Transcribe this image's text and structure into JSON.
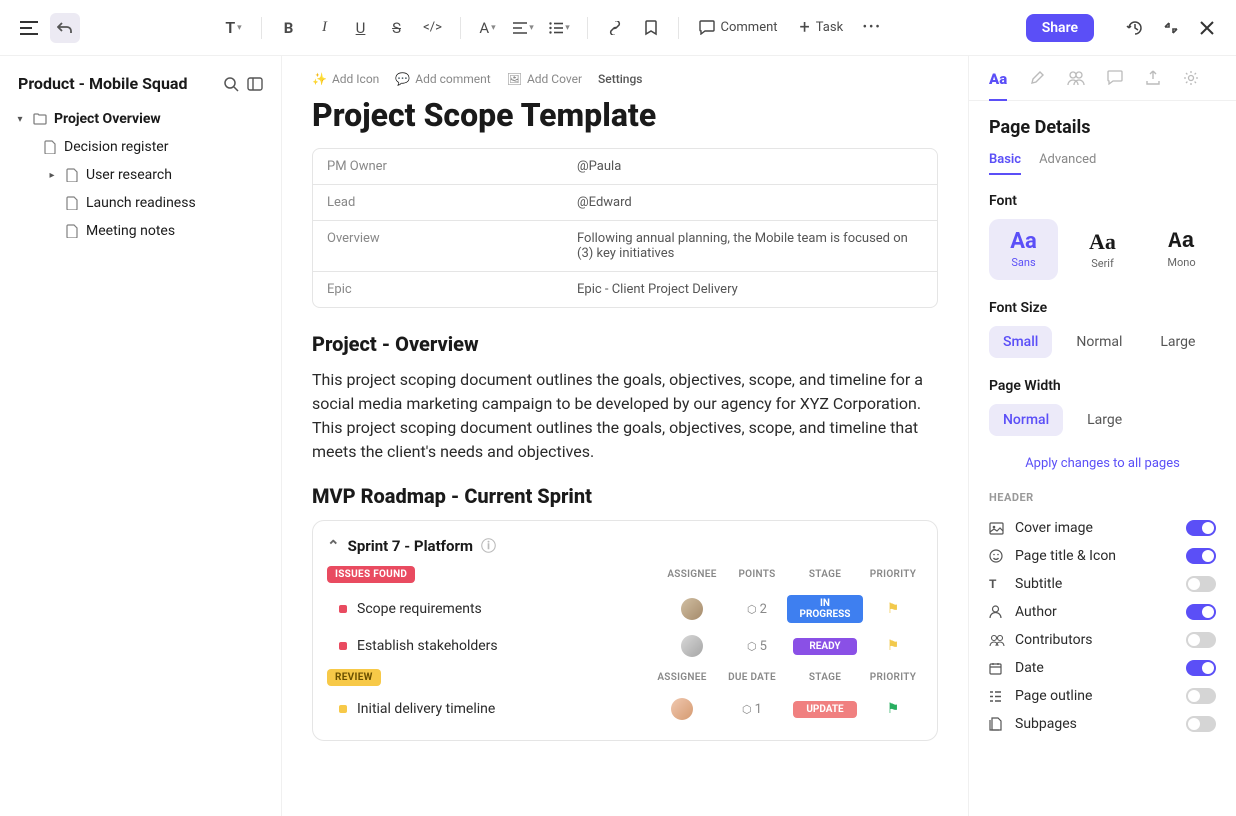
{
  "toolbar": {
    "comment": "Comment",
    "task": "Task",
    "share": "Share"
  },
  "sidebar": {
    "title": "Product - Mobile Squad",
    "tree": [
      {
        "label": "Project Overview",
        "bold": true,
        "expanded": true
      },
      {
        "label": "Decision register",
        "indent": 1
      },
      {
        "label": "User research",
        "indent": 2,
        "hasChildren": true
      },
      {
        "label": "Launch readiness",
        "indent": 2
      },
      {
        "label": "Meeting notes",
        "indent": 2
      }
    ]
  },
  "meta": {
    "addIcon": "Add Icon",
    "addComment": "Add comment",
    "addCover": "Add Cover",
    "settings": "Settings"
  },
  "page": {
    "title": "Project Scope Template",
    "info": [
      {
        "k": "PM Owner",
        "v": "@Paula"
      },
      {
        "k": "Lead",
        "v": "@Edward"
      },
      {
        "k": "Overview",
        "v": "Following annual planning, the Mobile team is focused on (3) key initiatives"
      },
      {
        "k": "Epic",
        "v": "Epic - Client Project Delivery"
      }
    ],
    "h2a": "Project - Overview",
    "para": "This project scoping document outlines the goals, objectives, scope, and timeline for a social media marketing campaign to be developed by our agency for XYZ Corporation. This project scoping document outlines the goals, objectives, scope, and timeline that meets the client's needs and objectives.",
    "h2b": "MVP Roadmap - Current Sprint"
  },
  "sprint": {
    "title": "Sprint  7 - Platform",
    "sections": [
      {
        "tag": "ISSUES FOUND",
        "tagClass": "tag-issues",
        "cols": [
          "ASSIGNEE",
          "POINTS",
          "STAGE",
          "PRIORITY"
        ],
        "tasks": [
          {
            "name": "Scope requirements",
            "points": "2",
            "stage": "IN PROGRESS",
            "stageClass": "st-progress",
            "flag": "flag-yellow",
            "avatar": ""
          },
          {
            "name": "Establish stakeholders",
            "points": "5",
            "stage": "READY",
            "stageClass": "st-ready",
            "flag": "flag-yellow",
            "avatar": "a2"
          }
        ]
      },
      {
        "tag": "REVIEW",
        "tagClass": "tag-review",
        "cols": [
          "ASSIGNEE",
          "DUE DATE",
          "STAGE",
          "PRIORITY"
        ],
        "tasks": [
          {
            "name": "Initial delivery timeline",
            "points": "1",
            "stage": "UPDATE",
            "stageClass": "st-update",
            "flag": "flag-green",
            "avatar": "a3",
            "dot": "dot-yellow"
          }
        ]
      }
    ]
  },
  "panel": {
    "title": "Page Details",
    "tabs": {
      "basic": "Basic",
      "advanced": "Advanced"
    },
    "fontLabel": "Font",
    "fonts": [
      {
        "sample": "Aa",
        "label": "Sans",
        "cls": "",
        "active": true
      },
      {
        "sample": "Aa",
        "label": "Serif",
        "cls": "font-serif"
      },
      {
        "sample": "Aa",
        "label": "Mono",
        "cls": "font-mono"
      }
    ],
    "sizeLabel": "Font Size",
    "sizes": [
      {
        "label": "Small",
        "active": true
      },
      {
        "label": "Normal"
      },
      {
        "label": "Large"
      }
    ],
    "widthLabel": "Page Width",
    "widths": [
      {
        "label": "Normal",
        "active": true
      },
      {
        "label": "Large"
      }
    ],
    "applyAll": "Apply changes to all pages",
    "headerLabel": "HEADER",
    "toggles": [
      {
        "label": "Cover image",
        "on": true,
        "icon": "image"
      },
      {
        "label": "Page title & Icon",
        "on": true,
        "icon": "smile"
      },
      {
        "label": "Subtitle",
        "on": false,
        "icon": "text"
      },
      {
        "label": "Author",
        "on": true,
        "icon": "user"
      },
      {
        "label": "Contributors",
        "on": false,
        "icon": "users"
      },
      {
        "label": "Date",
        "on": true,
        "icon": "calendar"
      },
      {
        "label": "Page outline",
        "on": false,
        "icon": "list"
      },
      {
        "label": "Subpages",
        "on": false,
        "icon": "pages"
      }
    ]
  }
}
